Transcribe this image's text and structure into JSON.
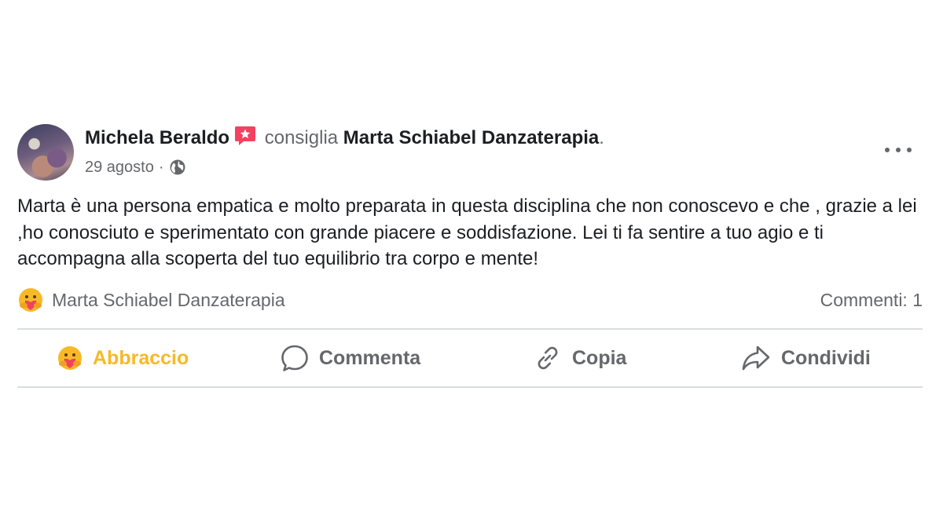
{
  "post": {
    "author": "Michela Beraldo",
    "verb": "consiglia",
    "page_name": "Marta Schiabel Danzaterapia",
    "period": ".",
    "date": "29 agosto",
    "body": "Marta è una persona empatica e molto preparata in questa disciplina che non conoscevo e che , grazie a lei ,ho conosciuto e sperimentato con grande piacere e soddisfazione. Lei ti fa sentire a tuo agio e ti accompagna alla scoperta del tuo equilibrio tra corpo e mente!",
    "reactions_label": "Marta Schiabel Danzaterapia",
    "comments_label": "Commenti: 1"
  },
  "actions": {
    "hug": "Abbraccio",
    "comment": "Commenta",
    "copy": "Copia",
    "share": "Condividi"
  },
  "icons": {
    "recommend": "recommend-star-icon",
    "privacy": "globe-icon",
    "more": "more-options-icon",
    "reaction": "hug-reaction-icon",
    "comment": "comment-bubble-icon",
    "copy": "link-icon",
    "share": "share-arrow-icon"
  },
  "colors": {
    "text_primary": "#1c1e21",
    "text_secondary": "#65676b",
    "hug_active": "#f7b928",
    "recommend_badge": "#f3425f",
    "divider": "#dadde1"
  }
}
